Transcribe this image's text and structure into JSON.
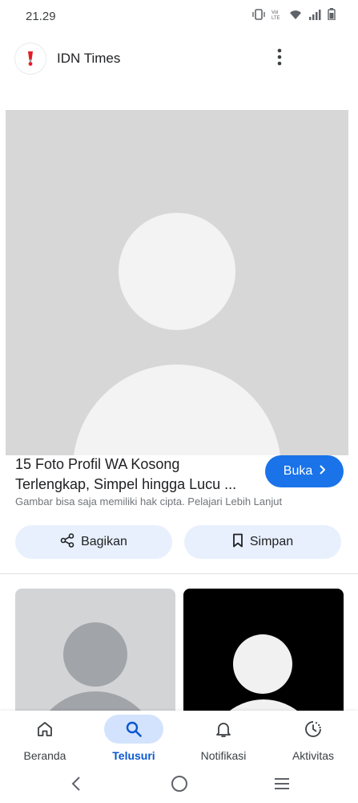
{
  "status_bar": {
    "time": "21.29",
    "icons": [
      "vibrate-icon",
      "volte-icon",
      "wifi-icon",
      "signal-icon",
      "battery-icon"
    ]
  },
  "header": {
    "source_name": "IDN Times",
    "menu_icon": "more-vert-icon"
  },
  "result": {
    "title": "15 Foto Profil WA Kosong Terlengkap, Simpel hingga Lucu ...",
    "open_label": "Buka",
    "copyright_notice": "Gambar bisa saja memiliki hak cipta. Pelajari Lebih Lanjut",
    "share_label": "Bagikan",
    "save_label": "Simpan"
  },
  "bottom_nav": {
    "items": [
      {
        "label": "Beranda",
        "icon": "home-icon",
        "active": false
      },
      {
        "label": "Telusuri",
        "icon": "search-icon",
        "active": true
      },
      {
        "label": "Notifikasi",
        "icon": "bell-icon",
        "active": false
      },
      {
        "label": "Aktivitas",
        "icon": "activity-icon",
        "active": false
      }
    ]
  },
  "colors": {
    "accent": "#1a73e8",
    "active_nav_bg": "#d3e3fd",
    "action_button_bg": "#e8f0fe",
    "placeholder_gray": "#d7d7d7"
  }
}
